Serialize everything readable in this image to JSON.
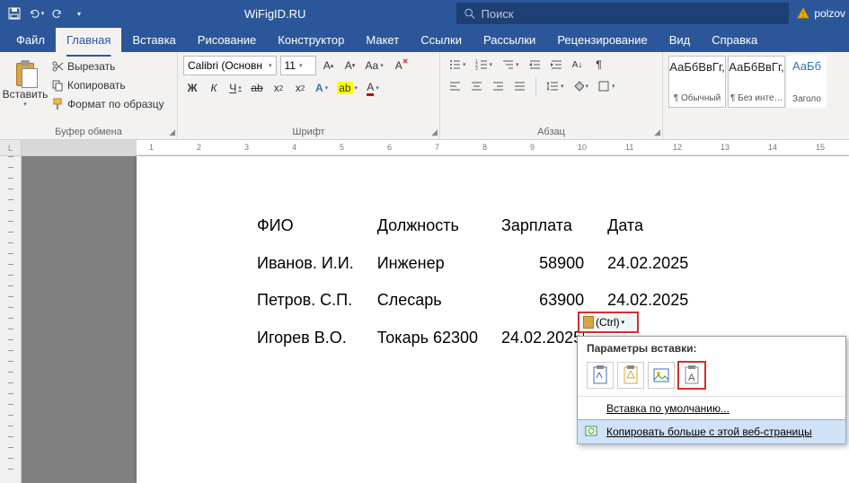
{
  "titlebar": {
    "filename": "WiFigID.RU",
    "search_placeholder": "Поиск",
    "user_name": "polzov"
  },
  "ribbon": {
    "tabs": {
      "file": "Файл",
      "home": "Главная",
      "insert": "Вставка",
      "draw": "Рисование",
      "design": "Конструктор",
      "layout": "Макет",
      "references": "Ссылки",
      "mailings": "Рассылки",
      "review": "Рецензирование",
      "view": "Вид",
      "help": "Справка"
    },
    "clipboard": {
      "paste": "Вставить",
      "cut": "Вырезать",
      "copy": "Копировать",
      "format_painter": "Формат по образцу",
      "group_label": "Буфер обмена"
    },
    "font": {
      "name": "Calibri (Основн",
      "size": "11",
      "group_label": "Шрифт"
    },
    "paragraph": {
      "group_label": "Абзац"
    },
    "styles": {
      "normal_sample": "АаБбВвГг,",
      "normal_name": "¶ Обычный",
      "nospace_sample": "АаБбВвГг,",
      "nospace_name": "¶ Без инте…",
      "heading1_sample": "АаБб",
      "heading1_name": "Заголо"
    }
  },
  "ruler": {
    "marks": [
      "1",
      "2",
      "3",
      "4",
      "5",
      "6",
      "7",
      "8",
      "9",
      "10",
      "11",
      "12",
      "13",
      "14",
      "15"
    ]
  },
  "document": {
    "header": {
      "c1": "ФИО",
      "c2": "Должность",
      "c3": "Зарплата",
      "c4": "Дата"
    },
    "rows": [
      {
        "c1": "Иванов. И.И.",
        "c2": "Инженер",
        "c3": "58900",
        "c4": "24.02.2025"
      },
      {
        "c1": "Петров. С.П.",
        "c2": "Слесарь",
        "c3": "63900",
        "c4": "24.02.2025"
      },
      {
        "c1": "Игорев В.О.",
        "c2": "Токарь 62300",
        "c3": "24.02.2025",
        "c4": ""
      }
    ]
  },
  "paste_popup": {
    "ctrl_label": "(Ctrl)",
    "header": "Параметры вставки:",
    "default_insert": "Вставка по умолчанию...",
    "copy_more": "Копировать больше с этой веб-страницы"
  }
}
